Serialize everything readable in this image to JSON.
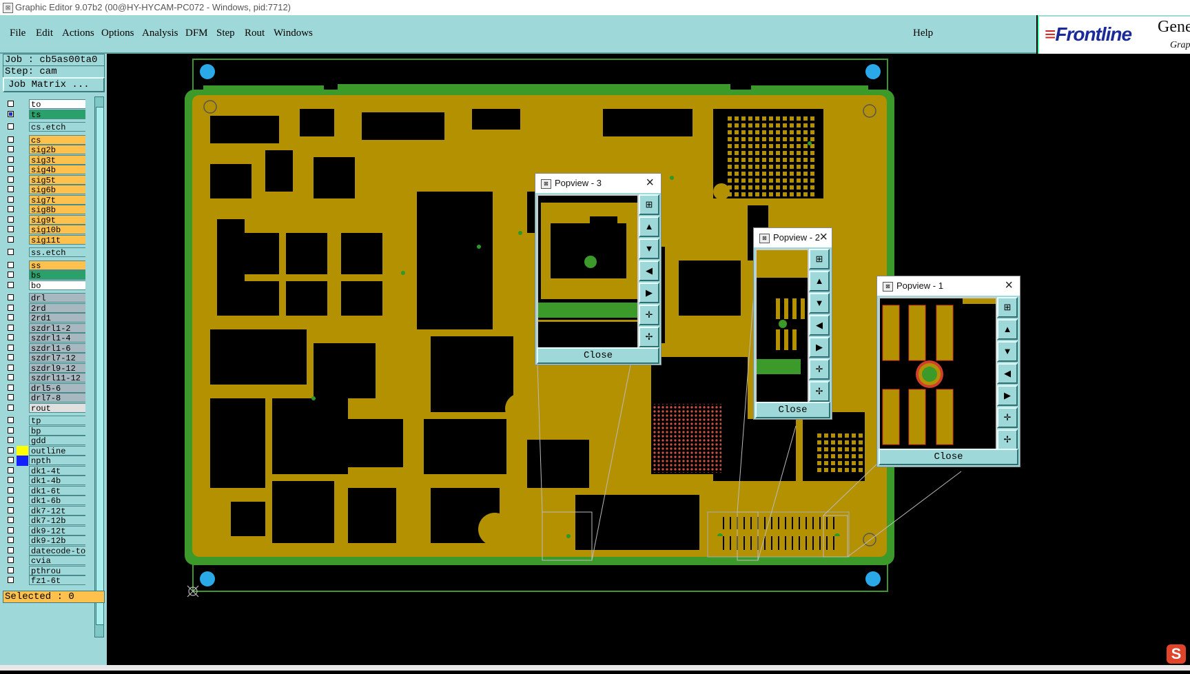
{
  "window": {
    "title": "Graphic Editor 9.07b2 (00@HY-HYCAM-PC072 - Windows, pid:7712)"
  },
  "menu": {
    "items": [
      "File",
      "Edit",
      "Actions",
      "Options",
      "Analysis",
      "DFM",
      "Step",
      "Rout",
      "Windows"
    ],
    "help": "Help"
  },
  "logo": {
    "brand": "Frontline",
    "product": "Gene",
    "sub": "Grap"
  },
  "job": {
    "job_label": "Job : cb5as00ta0",
    "step_label": "Step: cam",
    "matrix_button": "Job Matrix ..."
  },
  "layers": [
    {
      "name": "to",
      "color": "#ffffff",
      "checked": false,
      "swatch": ""
    },
    {
      "name": "ts",
      "color": "#2aa06a",
      "checked": true,
      "swatch": ""
    },
    {
      "name": "cs.etch",
      "color": "#9fd8d8",
      "checked": false,
      "swatch": ""
    },
    {
      "name": "cs",
      "color": "#ffc14d",
      "checked": false,
      "swatch": ""
    },
    {
      "name": "sig2b",
      "color": "#ffc14d",
      "checked": false,
      "swatch": ""
    },
    {
      "name": "sig3t",
      "color": "#ffc14d",
      "checked": false,
      "swatch": ""
    },
    {
      "name": "sig4b",
      "color": "#ffc14d",
      "checked": false,
      "swatch": ""
    },
    {
      "name": "sig5t",
      "color": "#ffc14d",
      "checked": false,
      "swatch": ""
    },
    {
      "name": "sig6b",
      "color": "#ffc14d",
      "checked": false,
      "swatch": ""
    },
    {
      "name": "sig7t",
      "color": "#ffc14d",
      "checked": false,
      "swatch": ""
    },
    {
      "name": "sig8b",
      "color": "#ffc14d",
      "checked": false,
      "swatch": ""
    },
    {
      "name": "sig9t",
      "color": "#ffc14d",
      "checked": false,
      "swatch": ""
    },
    {
      "name": "sig10b",
      "color": "#ffc14d",
      "checked": false,
      "swatch": ""
    },
    {
      "name": "sig11t",
      "color": "#ffc14d",
      "checked": false,
      "swatch": ""
    },
    {
      "name": "ss.etch",
      "color": "#9fd8d8",
      "checked": false,
      "swatch": ""
    },
    {
      "name": "ss",
      "color": "#ffc14d",
      "checked": false,
      "swatch": ""
    },
    {
      "name": "bs",
      "color": "#2aa06a",
      "checked": false,
      "swatch": ""
    },
    {
      "name": "bo",
      "color": "#ffffff",
      "checked": false,
      "swatch": ""
    },
    {
      "name": "drl",
      "color": "#a8b8c0",
      "checked": false,
      "swatch": ""
    },
    {
      "name": "2rd",
      "color": "#a8b8c0",
      "checked": false,
      "swatch": ""
    },
    {
      "name": "2rd1",
      "color": "#a8b8c0",
      "checked": false,
      "swatch": ""
    },
    {
      "name": "szdrl1-2",
      "color": "#a8b8c0",
      "checked": false,
      "swatch": ""
    },
    {
      "name": "szdrl1-4",
      "color": "#a8b8c0",
      "checked": false,
      "swatch": ""
    },
    {
      "name": "szdrl1-6",
      "color": "#a8b8c0",
      "checked": false,
      "swatch": ""
    },
    {
      "name": "szdrl7-12",
      "color": "#a8b8c0",
      "checked": false,
      "swatch": ""
    },
    {
      "name": "szdrl9-12",
      "color": "#a8b8c0",
      "checked": false,
      "swatch": ""
    },
    {
      "name": "szdrl11-12",
      "color": "#a8b8c0",
      "checked": false,
      "swatch": ""
    },
    {
      "name": "drl5-6",
      "color": "#a8b8c0",
      "checked": false,
      "swatch": ""
    },
    {
      "name": "drl7-8",
      "color": "#a8b8c0",
      "checked": false,
      "swatch": ""
    },
    {
      "name": "rout",
      "color": "#e0e0e0",
      "checked": false,
      "swatch": ""
    },
    {
      "name": "tp",
      "color": "#9fd8d8",
      "checked": false,
      "swatch": ""
    },
    {
      "name": "bp",
      "color": "#9fd8d8",
      "checked": false,
      "swatch": ""
    },
    {
      "name": "gdd",
      "color": "#9fd8d8",
      "checked": false,
      "swatch": ""
    },
    {
      "name": "outline",
      "color": "#9fd8d8",
      "checked": false,
      "swatch": "#ffff00"
    },
    {
      "name": "npth",
      "color": "#9fd8d8",
      "checked": false,
      "swatch": "#1020ff"
    },
    {
      "name": "dk1-4t",
      "color": "#9fd8d8",
      "checked": false,
      "swatch": ""
    },
    {
      "name": "dk1-4b",
      "color": "#9fd8d8",
      "checked": false,
      "swatch": ""
    },
    {
      "name": "dk1-6t",
      "color": "#9fd8d8",
      "checked": false,
      "swatch": ""
    },
    {
      "name": "dk1-6b",
      "color": "#9fd8d8",
      "checked": false,
      "swatch": ""
    },
    {
      "name": "dk7-12t",
      "color": "#9fd8d8",
      "checked": false,
      "swatch": ""
    },
    {
      "name": "dk7-12b",
      "color": "#9fd8d8",
      "checked": false,
      "swatch": ""
    },
    {
      "name": "dk9-12t",
      "color": "#9fd8d8",
      "checked": false,
      "swatch": ""
    },
    {
      "name": "dk9-12b",
      "color": "#9fd8d8",
      "checked": false,
      "swatch": ""
    },
    {
      "name": "datecode-to",
      "color": "#9fd8d8",
      "checked": false,
      "swatch": ""
    },
    {
      "name": "cvia",
      "color": "#9fd8d8",
      "checked": false,
      "swatch": ""
    },
    {
      "name": "pthrou",
      "color": "#9fd8d8",
      "checked": false,
      "swatch": ""
    },
    {
      "name": "fz1-6t",
      "color": "#9fd8d8",
      "checked": false,
      "swatch": ""
    }
  ],
  "status": {
    "selected": "Selected : 0"
  },
  "popviews": [
    {
      "title": "Popview - 3",
      "close": "Close"
    },
    {
      "title": "Popview - 2",
      "close": "Close"
    },
    {
      "title": "Popview - 1",
      "close": "Close"
    }
  ],
  "colors": {
    "board": "#b49100",
    "board_edge": "#3c9a2a",
    "panel": "#9fd8d8",
    "fiducial": "#2aa8e8"
  }
}
